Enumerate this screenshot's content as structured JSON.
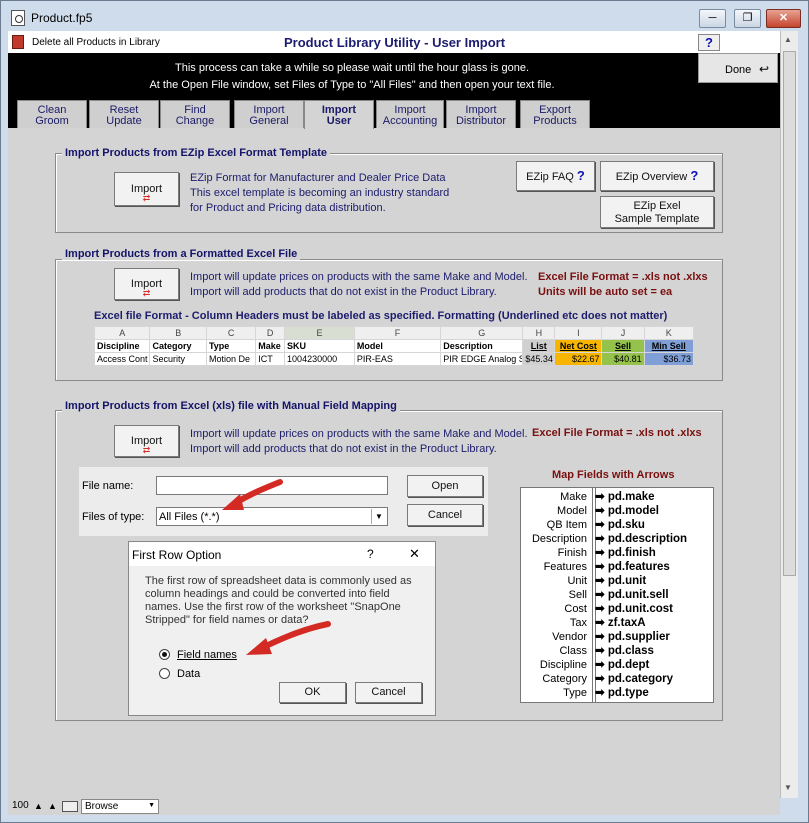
{
  "window": {
    "title": "Product.fp5",
    "minimize": "─",
    "restore": "❐",
    "close": "✕"
  },
  "header": {
    "delete_label": "Delete all Products in Library",
    "title": "Product Library Utility - User Import",
    "help": "?",
    "note_line1": "This process can take a while so please wait until the hour glass is gone.",
    "note_line2": "At the Open File window, set Files of Type to \"All Files\" and then open your text file.",
    "done_label": "Done"
  },
  "tabs": [
    {
      "l1": "Clean",
      "l2": "Groom"
    },
    {
      "l1": "Reset",
      "l2": "Update"
    },
    {
      "l1": "Find",
      "l2": "Change"
    },
    {
      "l1": "Import",
      "l2": "General"
    },
    {
      "l1": "Import",
      "l2": "User"
    },
    {
      "l1": "Import",
      "l2": "Accounting"
    },
    {
      "l1": "Import",
      "l2": "Distributor"
    },
    {
      "l1": "Export",
      "l2": "Products"
    }
  ],
  "ezip": {
    "label": "Import Products from EZip Excel Format Template",
    "import": "Import",
    "line1": "EZip Format for Manufacturer and Dealer Price Data",
    "line2": "This excel template is becoming an industry standard",
    "line3": "for Product and Pricing data distribution.",
    "faq": "EZip FAQ",
    "overview": "EZip Overview",
    "sample1": "EZip Exel",
    "sample2": "Sample Template",
    "q": "?"
  },
  "formatted": {
    "label": "Import Products from a Formatted Excel File",
    "import": "Import",
    "line1": "Import will update prices on products with the same Make and Model.",
    "line2": "Import will add products that do not exist in the Product Library.",
    "fmt1": "Excel File Format = .xls not .xlxs",
    "fmt2": "Units will be auto set = ea",
    "headers_note": "Excel file Format - Column Headers must be labeled as specified. Formatting (Underlined etc does not matter)",
    "columns": [
      "A",
      "B",
      "C",
      "D",
      "E",
      "F",
      "G",
      "H",
      "I",
      "J",
      "K"
    ],
    "headers": [
      "Discipline",
      "Category",
      "Type",
      "Make",
      "SKU",
      "Model",
      "Description",
      "List",
      "Net Cost",
      "Sell",
      "Min Sell"
    ],
    "row": [
      "Access Cont",
      "Security",
      "Motion De",
      "ICT",
      "1004230000",
      "PIR-EAS",
      "PIR EDGE Analog S",
      "$45.34",
      "$22.67",
      "$40.81",
      "$36.73"
    ]
  },
  "manual": {
    "label": "Import Products from Excel (xls) file with Manual Field Mapping",
    "import": "Import",
    "line1": "Import will update prices on products with the same Make and Model.",
    "line2": "Import will add products that do not exist in the Product Library.",
    "fmt": "Excel File Format = .xls not .xlxs"
  },
  "open_dialog": {
    "file_name_label": "File name:",
    "file_name_value": "",
    "files_of_type_label": "Files of type:",
    "files_of_type_value": "All Files (*.*)",
    "open": "Open",
    "cancel": "Cancel"
  },
  "first_row": {
    "title": "First Row Option",
    "help": "?",
    "close": "✕",
    "message": "The first row of spreadsheet data is commonly used as column headings and could be converted into field names. Use the first row of the worksheet \"SnapOne Stripped\" for field names or data?",
    "option_field": "Field names",
    "option_data": "Data",
    "selected": "Field names",
    "ok": "OK",
    "cancel": "Cancel"
  },
  "map": {
    "title": "Map Fields with Arrows",
    "rows": [
      {
        "src": "Make",
        "dst": "pd.make"
      },
      {
        "src": "Model",
        "dst": "pd.model"
      },
      {
        "src": "QB Item",
        "dst": "pd.sku"
      },
      {
        "src": "Description",
        "dst": "pd.description"
      },
      {
        "src": "Finish",
        "dst": "pd.finish"
      },
      {
        "src": "Features",
        "dst": "pd.features"
      },
      {
        "src": "Unit",
        "dst": "pd.unit"
      },
      {
        "src": "Sell",
        "dst": "pd.unit.sell"
      },
      {
        "src": "Cost",
        "dst": "pd.unit.cost"
      },
      {
        "src": "Tax",
        "dst": "zf.taxA"
      },
      {
        "src": "Vendor",
        "dst": "pd.supplier"
      },
      {
        "src": "Class",
        "dst": "pd.class"
      },
      {
        "src": "Discipline",
        "dst": "pd.dept"
      },
      {
        "src": "Category",
        "dst": "pd.category"
      },
      {
        "src": "Type",
        "dst": "pd.type"
      }
    ]
  },
  "status_bar": {
    "zoom": "100",
    "mode": "Browse"
  },
  "colors": {
    "arrow": "#d42a24",
    "net_cost": "#f7b500",
    "sell": "#94c24a",
    "min_sell": "#7f9fd6",
    "list": "#d0d0d0"
  }
}
